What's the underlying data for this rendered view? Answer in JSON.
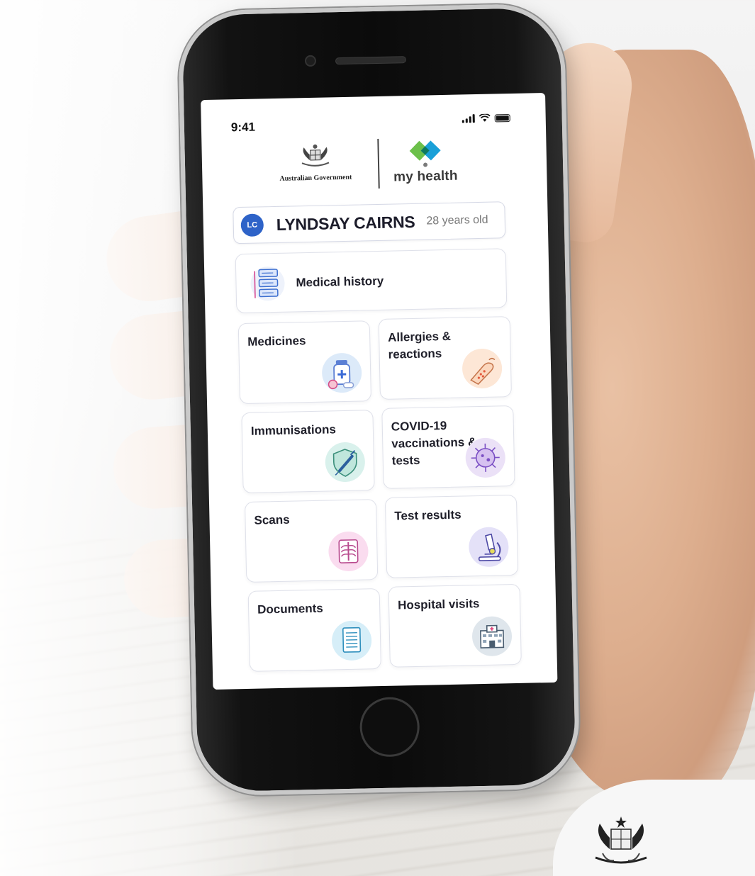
{
  "status_bar": {
    "time": "9:41"
  },
  "header": {
    "gov_label": "Australian Government",
    "app_label": "my health"
  },
  "profile": {
    "initials": "LC",
    "name": "LYNDSAY CAIRNS",
    "age": "28 years old"
  },
  "menu": {
    "medical_history": "Medical history",
    "tiles": [
      {
        "label": "Medicines",
        "icon": "medicine-bottle-icon"
      },
      {
        "label": "Allergies & reactions",
        "icon": "allergy-arm-icon"
      },
      {
        "label": "Immunisations",
        "icon": "syringe-shield-icon"
      },
      {
        "label": "COVID-19 vaccinations & tests",
        "icon": "virus-icon"
      },
      {
        "label": "Scans",
        "icon": "xray-icon"
      },
      {
        "label": "Test results",
        "icon": "microscope-icon"
      },
      {
        "label": "Documents",
        "icon": "document-icon"
      },
      {
        "label": "Hospital visits",
        "icon": "hospital-icon"
      }
    ]
  },
  "colors": {
    "avatar": "#2e63c8",
    "brand_green": "#6cc04a",
    "brand_blue": "#1aa0d8",
    "tile_border": "#dfe1ea"
  }
}
